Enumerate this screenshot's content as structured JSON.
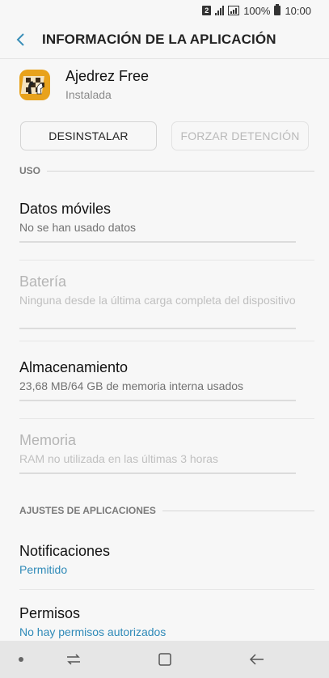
{
  "status_bar": {
    "sim": "2",
    "battery_percent": "100%",
    "time": "10:00"
  },
  "header": {
    "title": "INFORMACIÓN DE LA APLICACIÓN"
  },
  "app": {
    "name": "Ajedrez Free",
    "status": "Instalada",
    "icon_name": "chess-app-icon"
  },
  "buttons": {
    "uninstall": "DESINSTALAR",
    "force_stop": "FORZAR DETENCIÓN"
  },
  "sections": {
    "usage": "USO",
    "app_settings": "AJUSTES DE APLICACIONES"
  },
  "usage_items": {
    "mobile_data": {
      "title": "Datos móviles",
      "sub": "No se han usado datos"
    },
    "battery": {
      "title": "Batería",
      "sub": "Ninguna desde la última carga completa del dispositivo"
    },
    "storage": {
      "title": "Almacenamiento",
      "sub": "23,68 MB/64 GB de memoria interna usados"
    },
    "memory": {
      "title": "Memoria",
      "sub": "RAM no utilizada en las últimas 3 horas"
    }
  },
  "settings_items": {
    "notifications": {
      "title": "Notificaciones",
      "sub": "Permitido"
    },
    "permissions": {
      "title": "Permisos",
      "sub": "No hay permisos autorizados"
    }
  },
  "colors": {
    "accent_link": "#2f8ab8",
    "back_arrow": "#3a8fb8",
    "app_icon_bg": "#e8a21c"
  }
}
